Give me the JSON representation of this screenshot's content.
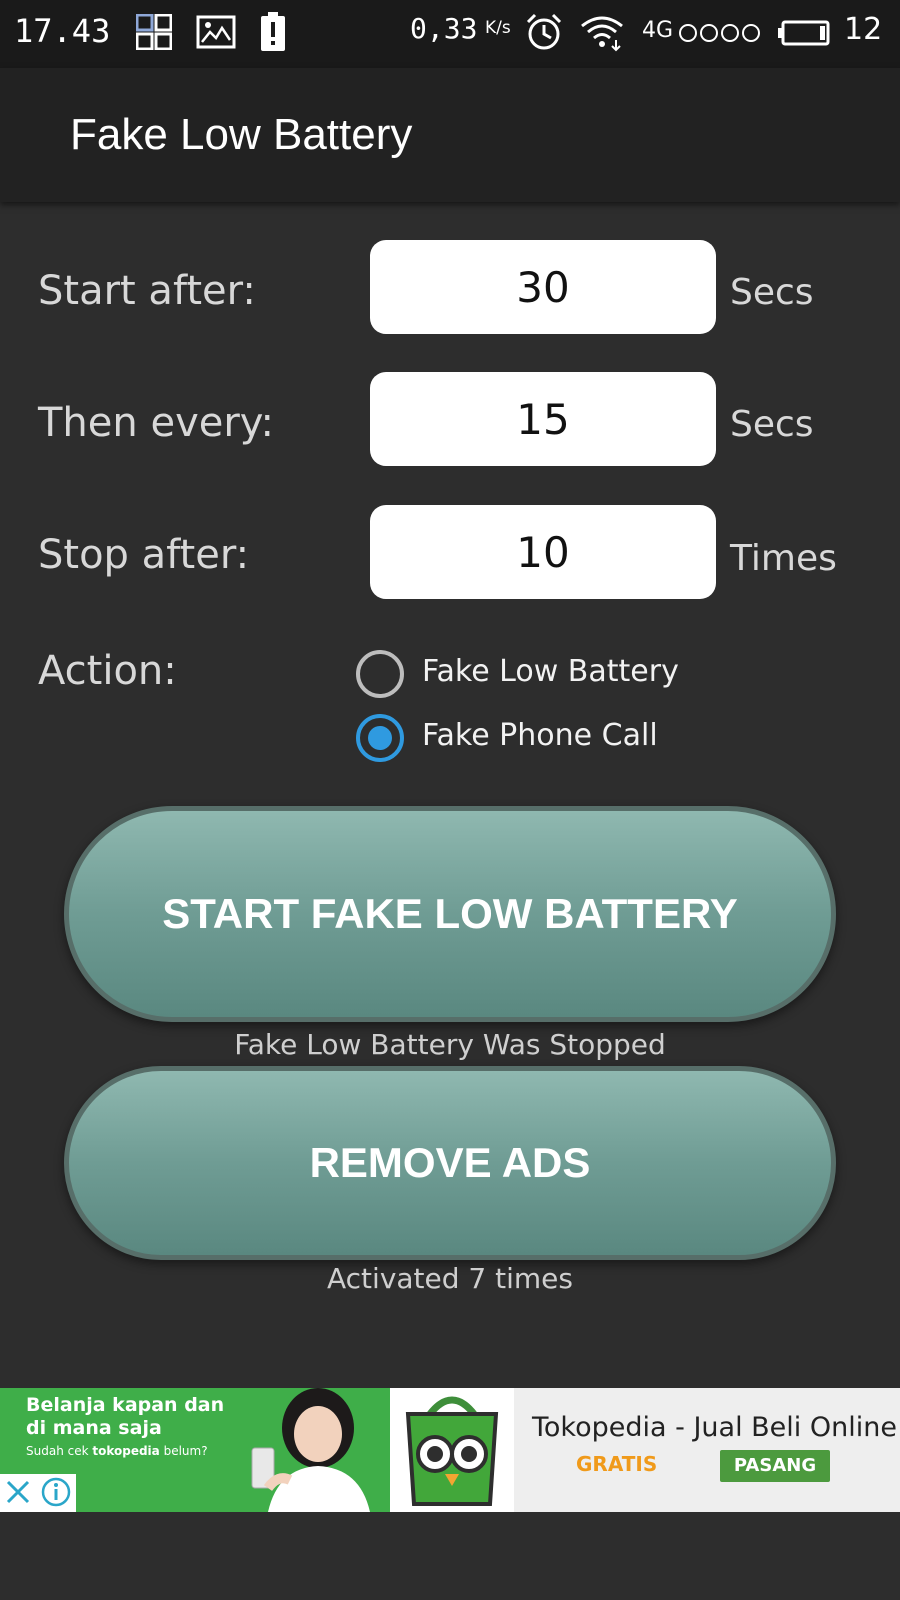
{
  "status_bar": {
    "time": "17.43",
    "net_speed": "0,33",
    "net_speed_unit": "K/s",
    "network_type": "4G",
    "battery_level": "12"
  },
  "app_bar": {
    "title": "Fake Low Battery"
  },
  "form": {
    "start_after": {
      "label": "Start after:",
      "value": "30",
      "unit": "Secs"
    },
    "then_every": {
      "label": "Then every:",
      "value": "15",
      "unit": "Secs"
    },
    "stop_after": {
      "label": "Stop after:",
      "value": "10",
      "unit": "Times"
    },
    "action": {
      "label": "Action:",
      "options": [
        {
          "label": "Fake Low Battery",
          "checked": false
        },
        {
          "label": "Fake Phone Call",
          "checked": true
        }
      ]
    }
  },
  "buttons": {
    "start_label": "START FAKE LOW BATTERY",
    "status_text": "Fake Low Battery Was Stopped",
    "remove_ads_label": "REMOVE ADS",
    "activation_text": "Activated 7 times"
  },
  "ad": {
    "headline": "Belanja kapan dan di mana saja",
    "subline_prefix": "Sudah cek ",
    "subline_brand": "tokopedia",
    "subline_suffix": " belum?",
    "app_name": "Tokopedia - Jual Beli Online",
    "price": "GRATIS",
    "install_label": "PASANG"
  }
}
